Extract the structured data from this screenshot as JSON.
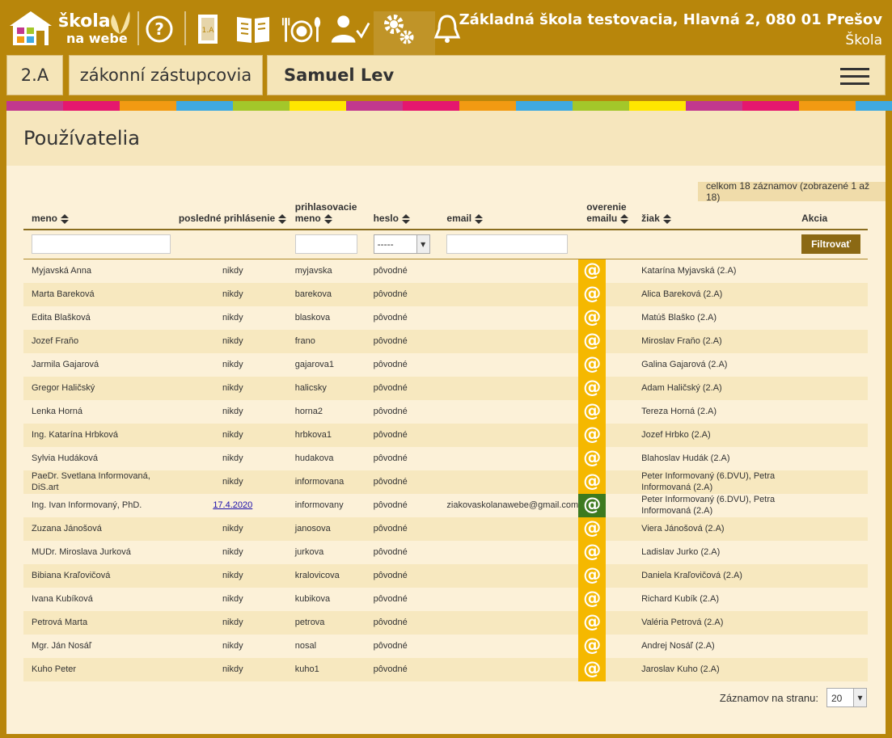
{
  "header": {
    "logo_line1": "škola",
    "logo_line2": "na webe",
    "school_name": "Základná škola testovacia, Hlavná 2, 080 01 Prešov",
    "school_sub": "Škola",
    "icons": [
      "help-icon",
      "class-book-icon",
      "open-book-icon",
      "lunch-icon",
      "teacher-check-icon",
      "settings-gears-icon",
      "bell-icon"
    ]
  },
  "nav": {
    "class_label": "2.A",
    "section_label": "zákonní zástupcovia",
    "user_label": "Samuel Lev"
  },
  "stripe_colors": [
    "#c2388e",
    "#e5176e",
    "#f29a12",
    "#3fa9e0",
    "#a3c72a",
    "#ffe600",
    "#c2388e",
    "#e5176e",
    "#f29a12",
    "#3fa9e0",
    "#a3c72a",
    "#ffe600",
    "#c2388e",
    "#e5176e",
    "#f29a12",
    "#3fa9e0"
  ],
  "page": {
    "title": "Používatelia",
    "count_text": "celkom 18 záznamov (zobrazené 1 až 18)",
    "filter_button": "Filtrovať",
    "heslo_filter_value": "-----",
    "per_page_label": "Záznamov na stranu:",
    "per_page_value": "20"
  },
  "columns": {
    "meno": "meno",
    "posledne": "posledné prihlásenie",
    "prihlas1": "prihlasovacie",
    "prihlas2": "meno",
    "heslo": "heslo",
    "email": "email",
    "overenie1": "overenie",
    "overenie2": "emailu",
    "ziak": "žiak",
    "akcia": "Akcia"
  },
  "rows": [
    {
      "meno": "Myjavská Anna",
      "posledne": "nikdy",
      "login": "myjavska",
      "heslo": "pôvodné",
      "email": "",
      "verified": false,
      "ziak": "Katarína Myjavská (2.A)"
    },
    {
      "meno": "Marta Bareková",
      "posledne": "nikdy",
      "login": "barekova",
      "heslo": "pôvodné",
      "email": "",
      "verified": false,
      "ziak": "Alica Bareková (2.A)"
    },
    {
      "meno": "Edita Blašková",
      "posledne": "nikdy",
      "login": "blaskova",
      "heslo": "pôvodné",
      "email": "",
      "verified": false,
      "ziak": "Matúš Blaško (2.A)"
    },
    {
      "meno": "Jozef Fraňo",
      "posledne": "nikdy",
      "login": "frano",
      "heslo": "pôvodné",
      "email": "",
      "verified": false,
      "ziak": "Miroslav Fraňo (2.A)"
    },
    {
      "meno": "Jarmila Gajarová",
      "posledne": "nikdy",
      "login": "gajarova1",
      "heslo": "pôvodné",
      "email": "",
      "verified": false,
      "ziak": "Galina Gajarová (2.A)"
    },
    {
      "meno": "Gregor Haličský",
      "posledne": "nikdy",
      "login": "halicsky",
      "heslo": "pôvodné",
      "email": "",
      "verified": false,
      "ziak": "Adam Haličský (2.A)"
    },
    {
      "meno": "Lenka Horná",
      "posledne": "nikdy",
      "login": "horna2",
      "heslo": "pôvodné",
      "email": "",
      "verified": false,
      "ziak": "Tereza Horná (2.A)"
    },
    {
      "meno": "Ing. Katarína Hrbková",
      "posledne": "nikdy",
      "login": "hrbkova1",
      "heslo": "pôvodné",
      "email": "",
      "verified": false,
      "ziak": "Jozef Hrbko (2.A)"
    },
    {
      "meno": "Sylvia Hudáková",
      "posledne": "nikdy",
      "login": "hudakova",
      "heslo": "pôvodné",
      "email": "",
      "verified": false,
      "ziak": "Blahoslav Hudák (2.A)"
    },
    {
      "meno": "PaeDr. Svetlana Informovaná, DiS.art",
      "posledne": "nikdy",
      "login": "informovana",
      "heslo": "pôvodné",
      "email": "",
      "verified": false,
      "ziak": "Peter Informovaný (6.DVU), Petra Informovaná (2.A)"
    },
    {
      "meno": "Ing. Ivan Informovaný, PhD.",
      "posledne": "17.4.2020",
      "login": "informovany",
      "heslo": "pôvodné",
      "email": "ziakovaskolanawebe@gmail.com",
      "verified": true,
      "ziak": "Peter Informovaný (6.DVU), Petra Informovaná (2.A)"
    },
    {
      "meno": "Zuzana Jánošová",
      "posledne": "nikdy",
      "login": "janosova",
      "heslo": "pôvodné",
      "email": "",
      "verified": false,
      "ziak": "Viera Jánošová (2.A)"
    },
    {
      "meno": "MUDr. Miroslava Jurková",
      "posledne": "nikdy",
      "login": "jurkova",
      "heslo": "pôvodné",
      "email": "",
      "verified": false,
      "ziak": "Ladislav Jurko (2.A)"
    },
    {
      "meno": "Bibiana Kraľovičová",
      "posledne": "nikdy",
      "login": "kralovicova",
      "heslo": "pôvodné",
      "email": "",
      "verified": false,
      "ziak": "Daniela Kraľovičová (2.A)"
    },
    {
      "meno": "Ivana Kubíková",
      "posledne": "nikdy",
      "login": "kubikova",
      "heslo": "pôvodné",
      "email": "",
      "verified": false,
      "ziak": "Richard Kubík (2.A)"
    },
    {
      "meno": "Petrová Marta",
      "posledne": "nikdy",
      "login": "petrova",
      "heslo": "pôvodné",
      "email": "",
      "verified": false,
      "ziak": "Valéria Petrová (2.A)"
    },
    {
      "meno": "Mgr. Ján Nosáľ",
      "posledne": "nikdy",
      "login": "nosal",
      "heslo": "pôvodné",
      "email": "",
      "verified": false,
      "ziak": "Andrej Nosáľ (2.A)"
    },
    {
      "meno": "Kuho Peter",
      "posledne": "nikdy",
      "login": "kuho1",
      "heslo": "pôvodné",
      "email": "",
      "verified": false,
      "ziak": "Jaroslav Kuho (2.A)"
    }
  ],
  "colors": {
    "brand": "#b8860b",
    "verified": "#3d7a1f",
    "unverified": "#f5b800",
    "filter_button": "#8b6914"
  }
}
